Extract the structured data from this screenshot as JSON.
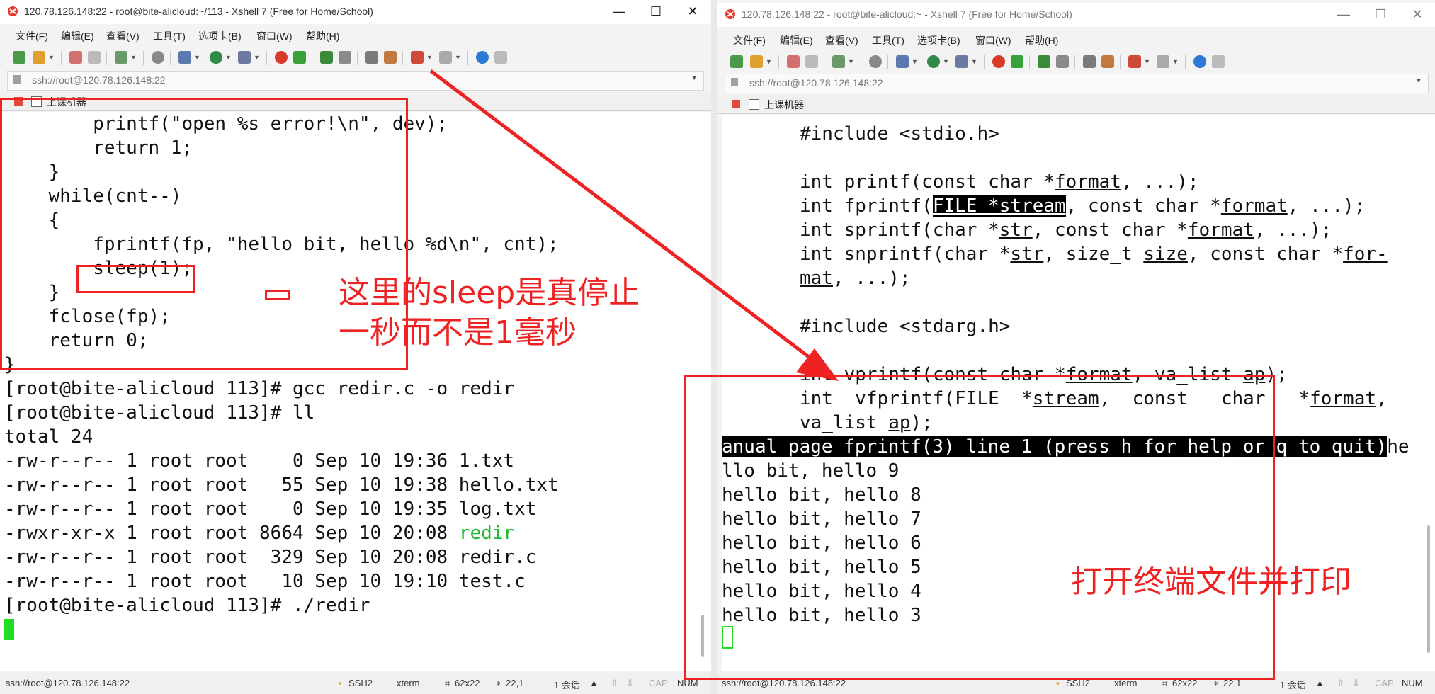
{
  "colors": {
    "annotation_red": "#ee2222",
    "terminal_bg": "#ffffff",
    "cursor_green": "#22dd22",
    "executable_green": "#22bb33",
    "pager_status_bg": "#000000"
  },
  "left_window": {
    "title": "120.78.126.148:22 - root@bite-alicloud:~/113 - Xshell 7 (Free for Home/School)",
    "window_buttons": {
      "minimize": "—",
      "maximize": "☐",
      "close": "✕"
    },
    "menu": [
      "文件(F)",
      "编辑(E)",
      "查看(V)",
      "工具(T)",
      "选项卡(B)",
      "窗口(W)",
      "帮助(H)"
    ],
    "address": "ssh://root@120.78.126.148:22",
    "tab_label": "上课机器",
    "terminal_lines": [
      "        printf(\"open %s error!\\n\", dev);",
      "        return 1;",
      "    }",
      "    while(cnt--)",
      "    {",
      "        fprintf(fp, \"hello bit, hello %d\\n\", cnt);",
      "        sleep(1);",
      "    }",
      "    fclose(fp);",
      "    return 0;",
      "}",
      "[root@bite-alicloud 113]# gcc redir.c -o redir",
      "[root@bite-alicloud 113]# ll",
      "total 24"
    ],
    "ls_rows": [
      {
        "meta": "-rw-r--r-- 1 root root    0 Sep 10 19:36 ",
        "name": "1.txt",
        "exec": false
      },
      {
        "meta": "-rw-r--r-- 1 root root   55 Sep 10 19:38 ",
        "name": "hello.txt",
        "exec": false
      },
      {
        "meta": "-rw-r--r-- 1 root root    0 Sep 10 19:35 ",
        "name": "log.txt",
        "exec": false
      },
      {
        "meta": "-rwxr-xr-x 1 root root 8664 Sep 10 20:08 ",
        "name": "redir",
        "exec": true
      },
      {
        "meta": "-rw-r--r-- 1 root root  329 Sep 10 20:08 ",
        "name": "redir.c",
        "exec": false
      },
      {
        "meta": "-rw-r--r-- 1 root root   10 Sep 10 19:10 ",
        "name": "test.c",
        "exec": false
      }
    ],
    "last_command": "[root@bite-alicloud 113]# ./redir",
    "status": {
      "address": "ssh://root@120.78.126.148:22",
      "protocol": "SSH2",
      "term": "xterm",
      "size": "62x22",
      "position": "22,1",
      "sessions": "1 会话",
      "caps": "CAP",
      "num": "NUM"
    }
  },
  "right_window": {
    "title": "120.78.126.148:22 - root@bite-alicloud:~ - Xshell 7 (Free for Home/School)",
    "window_buttons": {
      "minimize": "—",
      "maximize": "☐",
      "close": "✕"
    },
    "menu": [
      "文件(F)",
      "编辑(E)",
      "查看(V)",
      "工具(T)",
      "选项卡(B)",
      "窗口(W)",
      "帮助(H)"
    ],
    "address": "ssh://root@120.78.126.148:22",
    "tab_label": "上课机器",
    "man": {
      "include_stdio": "#include <stdio.h>",
      "printf_a": "int printf(const char *",
      "format": "format",
      "printf_b": ", ...);",
      "fprintf_a": "int fprintf(",
      "file_stream": "FILE *stream",
      "fprintf_b": ", const char *",
      "fprintf_c": ", ...);",
      "sprintf_a": "int sprintf(char *",
      "str": "str",
      "sprintf_b": ", const char *",
      "sprintf_c": ", ...);",
      "snprintf_a": "int snprintf(char *",
      "snprintf_b": ", size_t ",
      "size": "size",
      "snprintf_c": ", const char *",
      "for_": "for-",
      "mat": "mat",
      "mat_rest": ", ...);",
      "include_stdarg": "#include <stdarg.h>",
      "vprintf_a": "int vprintf(const char *",
      "vprintf_b": ", va_list ",
      "ap": "ap",
      "vprintf_c": ");",
      "vfprintf_a": "int  vfprintf(FILE  *",
      "stream": "stream",
      "vfprintf_b": ",  const   char   *",
      "vfprintf_c": ",",
      "valist": "va_list ",
      "valist_end": ");"
    },
    "pager_status": "anual page fprintf(3) line 1 (press h for help or q to quit)",
    "pager_tail": "he",
    "output_lines": [
      "llo bit, hello 9",
      "hello bit, hello 8",
      "hello bit, hello 7",
      "hello bit, hello 6",
      "hello bit, hello 5",
      "hello bit, hello 4",
      "hello bit, hello 3"
    ],
    "status": {
      "address": "ssh://root@120.78.126.148:22",
      "protocol": "SSH2",
      "term": "xterm",
      "size": "62x22",
      "position": "22,1",
      "sessions": "1 会话",
      "caps": "CAP",
      "num": "NUM"
    }
  },
  "annotations": {
    "sleep_note_line1": "这里的sleep是真停止",
    "sleep_note_line2": "一秒而不是1毫秒",
    "open_note": "打开终端文件并打印"
  }
}
